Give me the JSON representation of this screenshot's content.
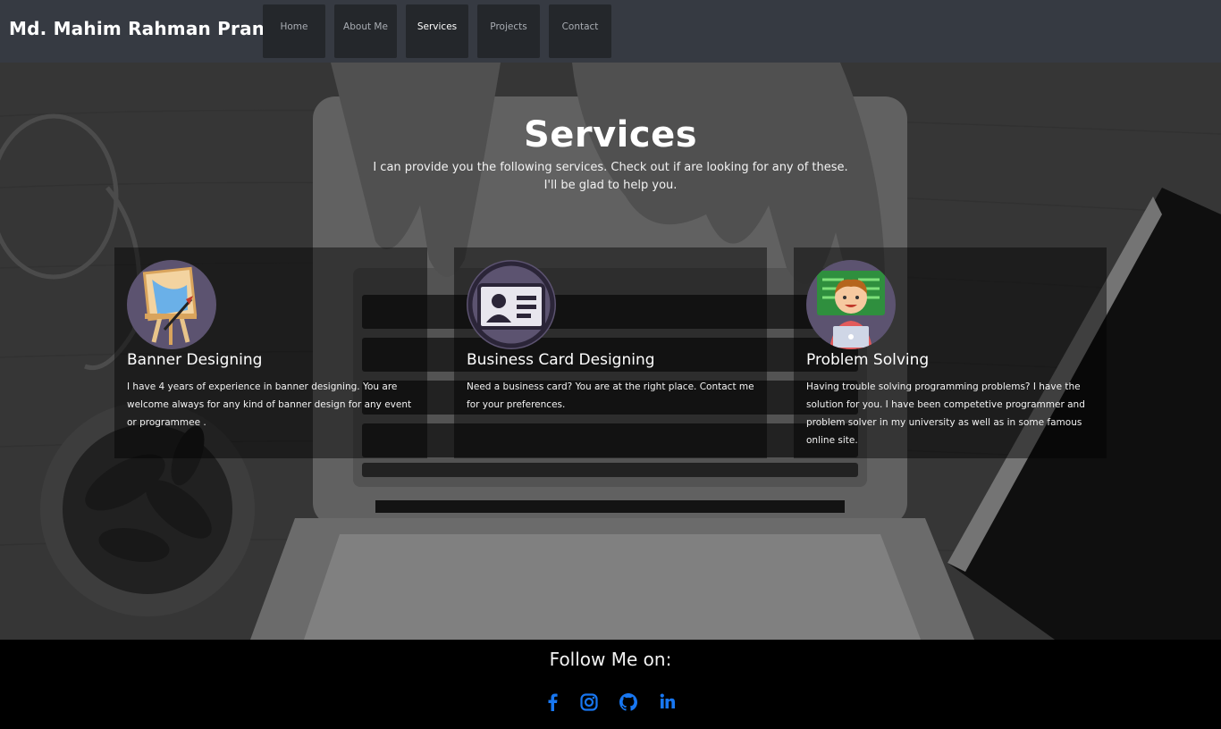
{
  "header": {
    "brand": "Md. Mahim Rahman Pranto",
    "nav": [
      {
        "label": "Home",
        "active": false
      },
      {
        "label": "About Me",
        "active": false
      },
      {
        "label": "Services",
        "active": true
      },
      {
        "label": "Projects",
        "active": false
      },
      {
        "label": "Contact",
        "active": false
      }
    ]
  },
  "services": {
    "title": "Services",
    "subtitle_line1": "I can provide you the following services. Check out if are looking for any of these.",
    "subtitle_line2": "I'll be glad to help you.",
    "cards": [
      {
        "icon": "easel-icon",
        "title": "Banner Designing",
        "text": "I have 4 years of experience in banner designing. You are welcome always for any kind of banner design for any event or programmee ."
      },
      {
        "icon": "business-card-icon",
        "title": "Business Card Designing",
        "text": "Need a business card? You are at the right place. Contact me for your preferences."
      },
      {
        "icon": "programmer-icon",
        "title": "Problem Solving",
        "text": "Having trouble solving programming problems? I have the solution for you. I have been competetive programmer and problem solver in my university as well as in some famous online site."
      }
    ]
  },
  "footer": {
    "follow_label": "Follow Me on:",
    "socials": [
      {
        "icon": "facebook-icon"
      },
      {
        "icon": "instagram-icon"
      },
      {
        "icon": "github-icon"
      },
      {
        "icon": "linkedin-icon"
      }
    ],
    "social_color": "#1877f2"
  },
  "colors": {
    "header_bg": "#363a42",
    "nav_bg": "#24272b",
    "icon_circle": "#5c5370"
  }
}
